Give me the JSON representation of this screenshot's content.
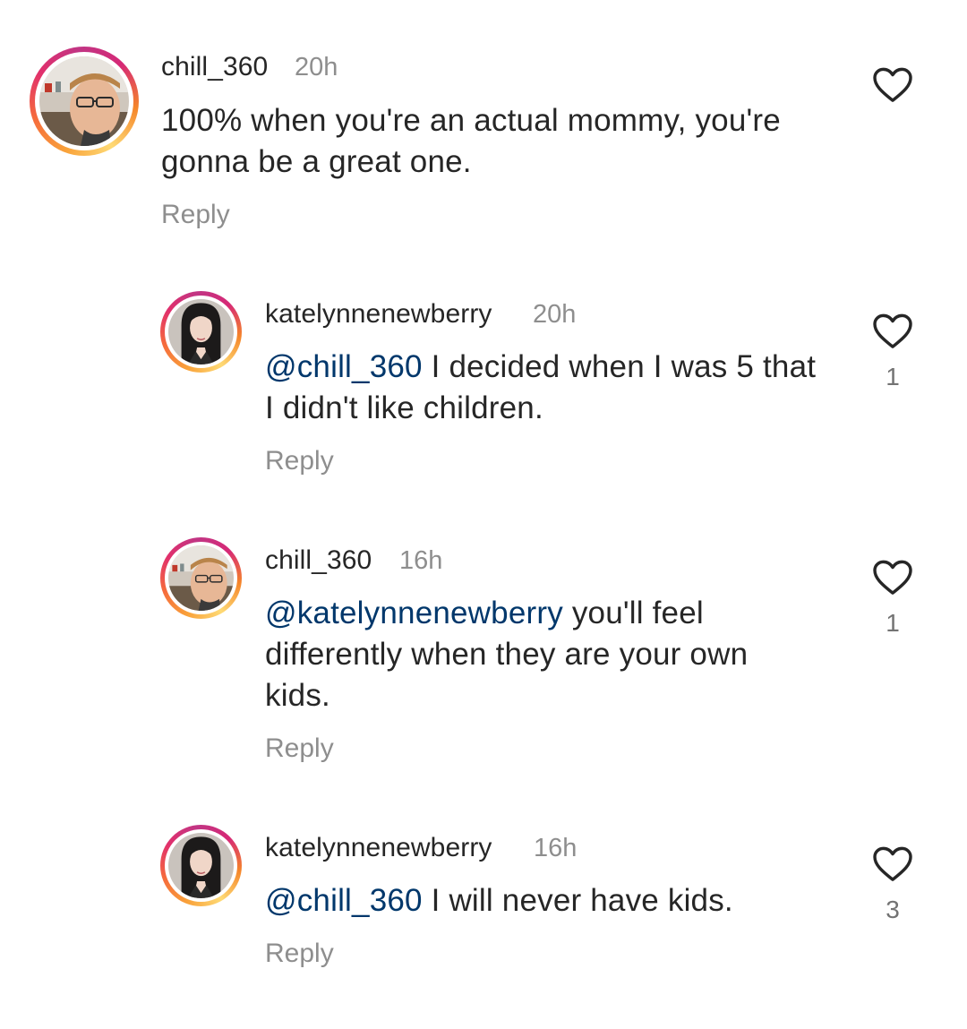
{
  "icons": {
    "like": "heart-outline-icon",
    "avatar_male": "avatar-man-glasses",
    "avatar_female": "avatar-woman-dark-hair"
  },
  "colors": {
    "mention": "#00376b",
    "secondary_text": "#8e8e8e",
    "primary_text": "#262626",
    "story_ring": [
      "#feda75",
      "#f58529",
      "#e1306c",
      "#c13584"
    ]
  },
  "comments": [
    {
      "username": "chill_360",
      "time": "20h",
      "mention": "",
      "text": "100% when you're an actual mommy, you're gonna be a great one.",
      "reply_label": "Reply",
      "likes": ""
    },
    {
      "username": "katelynnenewberry",
      "time": "20h",
      "mention": "@chill_360",
      "text": " I decided when I was 5 that I didn't like children.",
      "reply_label": "Reply",
      "likes": "1"
    },
    {
      "username": "chill_360",
      "time": "16h",
      "mention": "@katelynnenewberry",
      "text": " you'll feel differently when they are your own kids.",
      "reply_label": "Reply",
      "likes": "1"
    },
    {
      "username": "katelynnenewberry",
      "time": "16h",
      "mention": "@chill_360",
      "text": " I will never have kids.",
      "reply_label": "Reply",
      "likes": "3"
    }
  ]
}
